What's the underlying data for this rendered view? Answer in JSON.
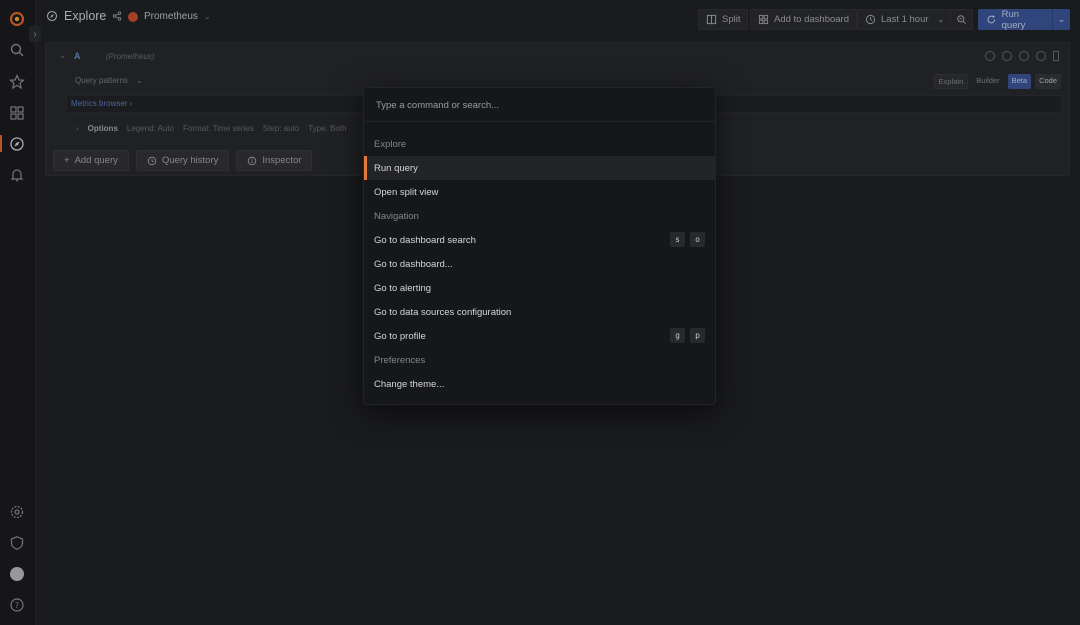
{
  "header": {
    "title": "Explore",
    "datasource": "Prometheus",
    "split_label": "Split",
    "add_to_dashboard_label": "Add to dashboard",
    "time_range": "Last 1 hour",
    "run_query_label": "Run query"
  },
  "query": {
    "letter": "A",
    "datasource": "(Prometheus)",
    "patterns_label": "Query patterns",
    "mode_explain": "Explain",
    "mode_builder": "Builder",
    "mode_beta": "Beta",
    "mode_code": "Code",
    "metrics_browser": "Metrics browser",
    "options_label": "Options",
    "legend": "Legend: Auto",
    "format": "Format: Time series",
    "step": "Step: auto",
    "type": "Type: Both"
  },
  "actions": {
    "add_query": "Add query",
    "query_history": "Query history",
    "inspector": "Inspector"
  },
  "palette": {
    "placeholder": "Type a command or search...",
    "items": [
      {
        "label": "Explore",
        "section": true
      },
      {
        "label": "Run query",
        "selected": true
      },
      {
        "label": "Open split view"
      },
      {
        "label": "Navigation",
        "section": true
      },
      {
        "label": "Go to dashboard search",
        "keys": [
          "s",
          "o"
        ]
      },
      {
        "label": "Go to dashboard..."
      },
      {
        "label": "Go to alerting"
      },
      {
        "label": "Go to data sources configuration"
      },
      {
        "label": "Go to profile",
        "keys": [
          "g",
          "p"
        ]
      },
      {
        "label": "Preferences",
        "section": true
      },
      {
        "label": "Change theme..."
      }
    ]
  },
  "colors": {
    "accent": "#e07b3c",
    "primary": "#3a5596",
    "background": "#202124"
  }
}
